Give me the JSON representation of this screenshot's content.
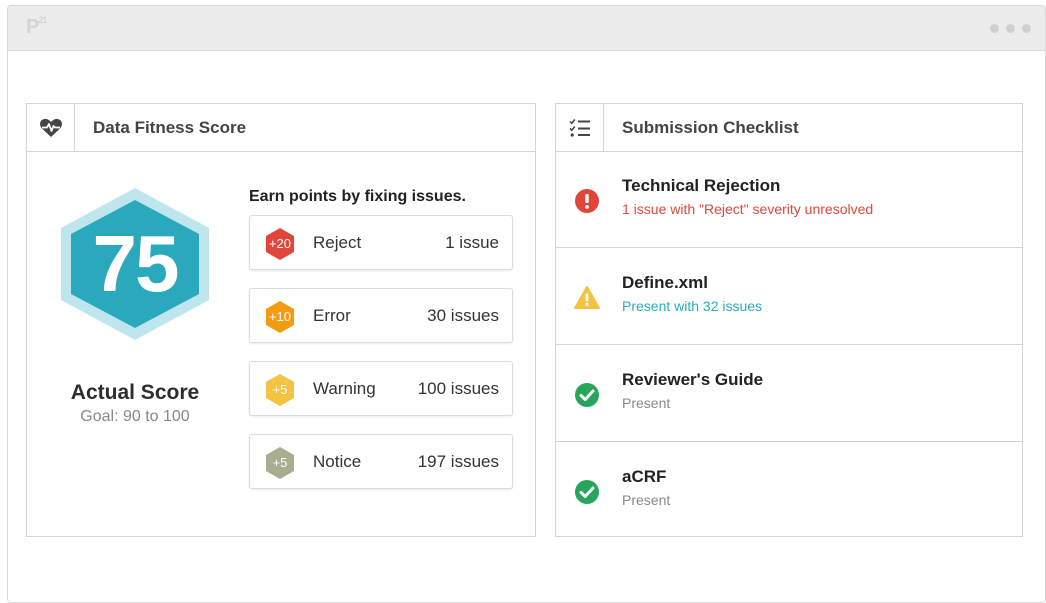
{
  "app": {
    "logo": "P",
    "logo_sup": "21"
  },
  "fitness": {
    "title": "Data Fitness Score",
    "icon": "heart-pulse-icon",
    "score": "75",
    "score_label": "Actual Score",
    "goal": "Goal: 90 to 100",
    "earn_text": "Earn points by fixing issues.",
    "issues": [
      {
        "badge": "+20",
        "label": "Reject",
        "count": "1 issue",
        "color": "#e0463a",
        "icon": "hexagon-badge-icon"
      },
      {
        "badge": "+10",
        "label": "Error",
        "count": "30 issues",
        "color": "#f39c12",
        "icon": "hexagon-badge-icon"
      },
      {
        "badge": "+5",
        "label": "Warning",
        "count": "100 issues",
        "color": "#f5c342",
        "icon": "hexagon-badge-icon"
      },
      {
        "badge": "+5",
        "label": "Notice",
        "count": "197 issues",
        "color": "#a9ad90",
        "icon": "hexagon-badge-icon"
      }
    ],
    "hex_color": "#2aa9bc",
    "hex_outer_color": "#bfe6ec"
  },
  "checklist": {
    "title": "Submission Checklist",
    "icon": "checklist-icon",
    "items": [
      {
        "title": "Technical Rejection",
        "subtitle": "1 issue with \"Reject\" severity unresolved",
        "status": "error",
        "icon": "error-circle-icon",
        "sub_color": "#e0463a"
      },
      {
        "title": "Define.xml",
        "subtitle": "Present with 32 issues",
        "status": "warning",
        "icon": "warning-triangle-icon",
        "sub_color": "#26aebf"
      },
      {
        "title": "Reviewer's Guide",
        "subtitle": "Present",
        "status": "ok",
        "icon": "check-circle-icon",
        "sub_color": "#8a8a8a"
      },
      {
        "title": "aCRF",
        "subtitle": "Present",
        "status": "ok",
        "icon": "check-circle-icon",
        "sub_color": "#8a8a8a"
      }
    ]
  }
}
